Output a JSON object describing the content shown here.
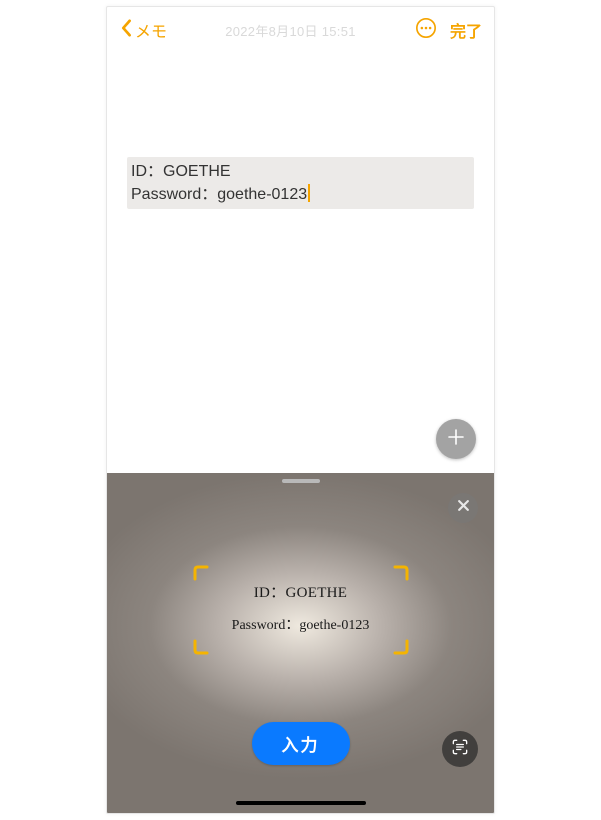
{
  "header": {
    "back_label": "メモ",
    "timestamp": "2022年8月10日 15:51",
    "done_label": "完了"
  },
  "note": {
    "line1": "ID：GOETHE",
    "line2": "Password：goethe-0123"
  },
  "scanner": {
    "line1": "ID：GOETHE",
    "line2": "Password：goethe-0123",
    "insert_label": "入力"
  },
  "colors": {
    "accent": "#f5a400",
    "primary_blue": "#0a7aff"
  }
}
